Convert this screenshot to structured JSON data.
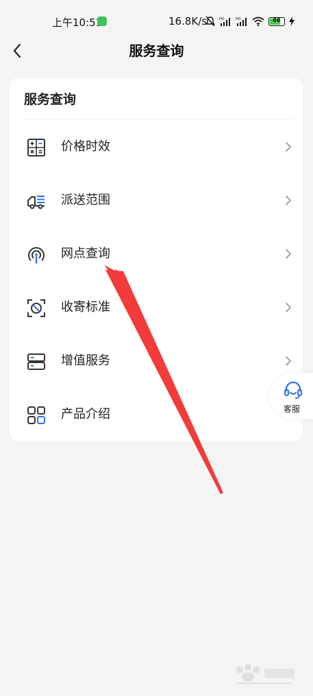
{
  "status_bar": {
    "time": "上午10:51",
    "network_speed": "16.8K/s",
    "battery": "66"
  },
  "nav": {
    "title": "服务查询"
  },
  "card": {
    "title": "服务查询",
    "items": [
      {
        "label": "价格时效",
        "icon": "calculator-icon"
      },
      {
        "label": "派送范围",
        "icon": "delivery-truck-icon"
      },
      {
        "label": "网点查询",
        "icon": "signal-tower-icon"
      },
      {
        "label": "收寄标准",
        "icon": "prohibited-scan-icon"
      },
      {
        "label": "增值服务",
        "icon": "server-stack-icon"
      },
      {
        "label": "产品介绍",
        "icon": "grid-apps-icon"
      }
    ]
  },
  "customer_service": {
    "label": "客服",
    "icon": "headset-icon"
  },
  "colors": {
    "accent_blue": "#2f6cf6",
    "icon_gray": "#333333",
    "annotation_red": "#f23b3b",
    "background": "#f4f4f4"
  }
}
